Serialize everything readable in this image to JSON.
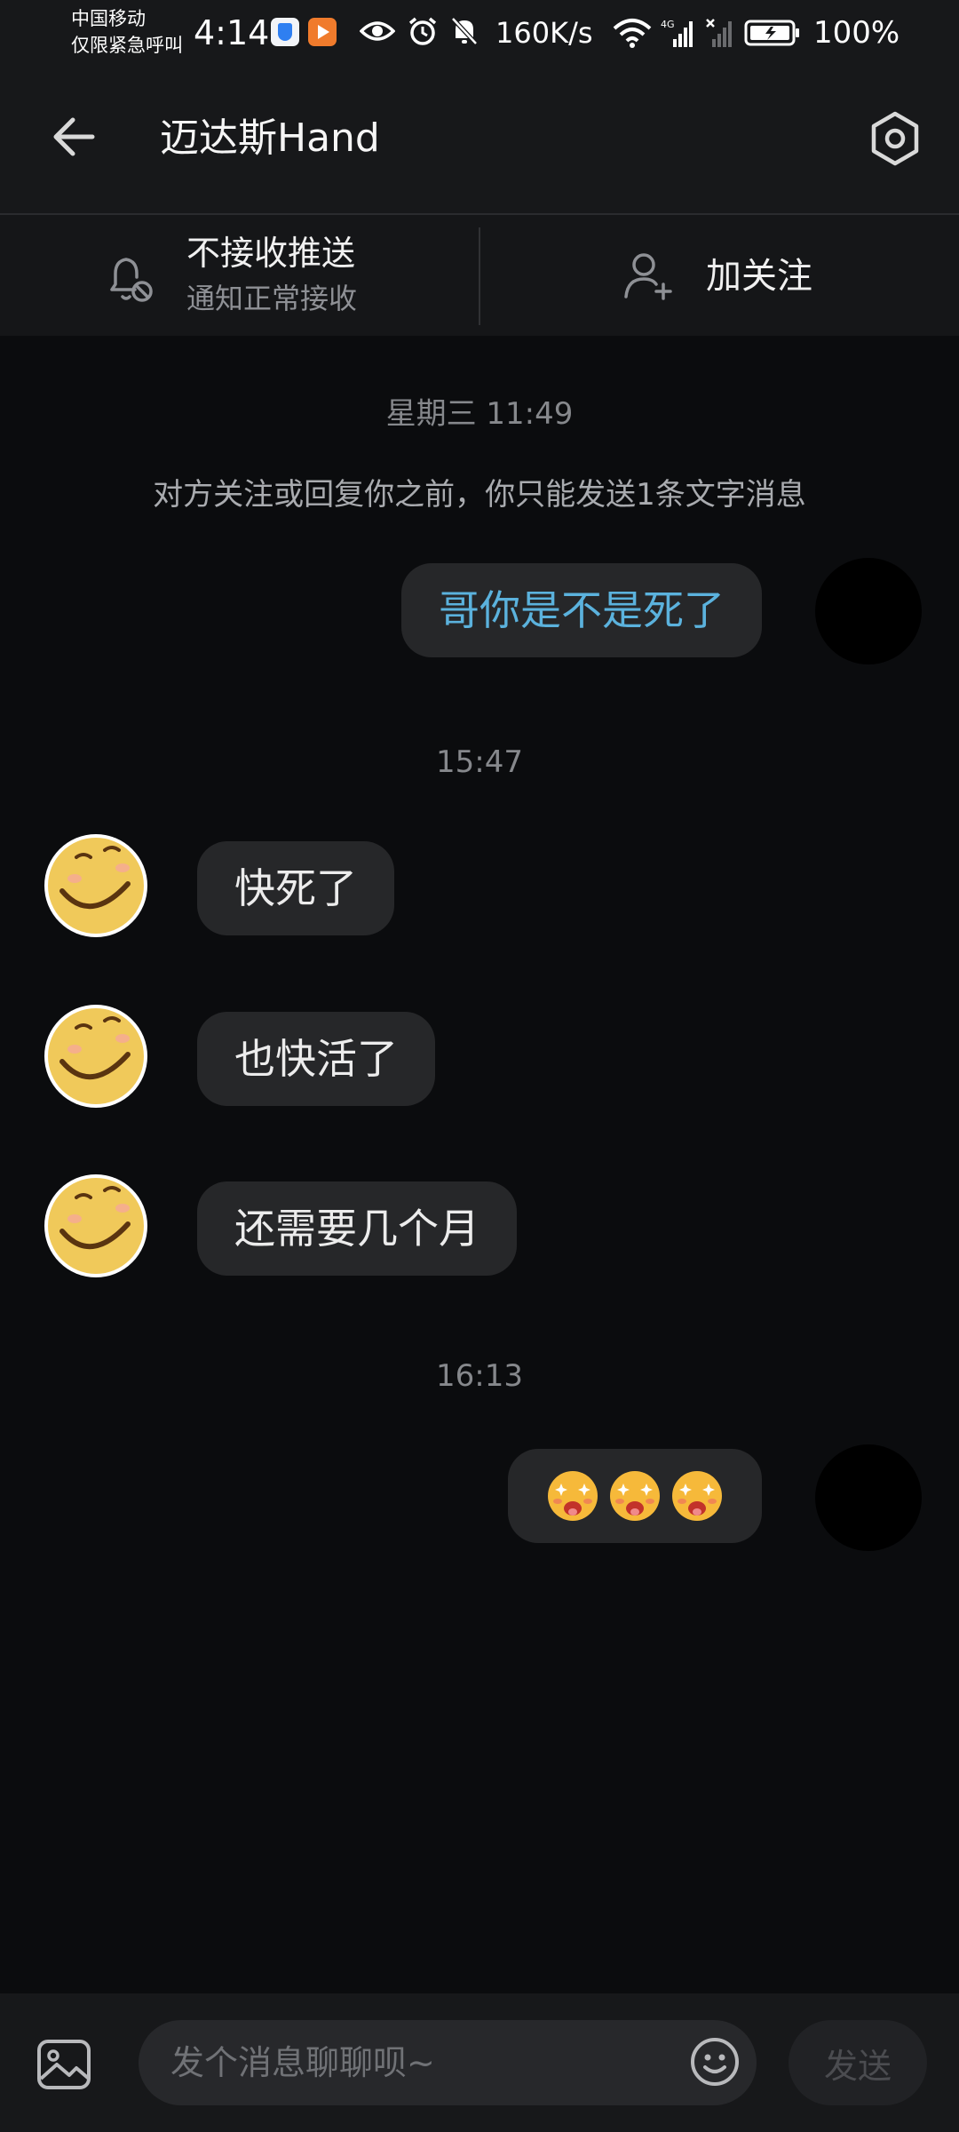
{
  "status_bar": {
    "carrier_line1": "中国移动",
    "carrier_line2": "仅限紧急呼叫",
    "time": "4:14",
    "net_speed": "160K/s",
    "network_type": "4G",
    "battery": "100%",
    "icons": [
      "shield-app-icon",
      "video-app-icon",
      "eye-icon",
      "alarm-icon",
      "mute-bell-icon",
      "wifi-icon",
      "signal-icon",
      "no-signal-icon",
      "battery-icon"
    ]
  },
  "header": {
    "title": "迈达斯Hand",
    "back_icon": "arrow-left-icon",
    "settings_icon": "hexagon-settings-icon"
  },
  "actions": {
    "push_label": "不接收推送",
    "push_sub": "通知正常接收",
    "follow_label": "加关注"
  },
  "chat": {
    "notice": "对方关注或回复你之前，你只能发送1条文字消息",
    "groups": [
      {
        "timestamp": "星期三 11:49"
      },
      {
        "timestamp": "15:47"
      },
      {
        "timestamp": "16:13"
      }
    ],
    "messages": [
      {
        "from": "me",
        "text": "哥你是不是死了"
      },
      {
        "from": "them",
        "text": "快死了"
      },
      {
        "from": "them",
        "text": "也快活了"
      },
      {
        "from": "them",
        "text": "还需要几个月"
      },
      {
        "from": "me",
        "type": "emoji",
        "emoji": [
          "star-eyes-emoji",
          "star-eyes-emoji",
          "star-eyes-emoji"
        ]
      }
    ]
  },
  "input_bar": {
    "placeholder": "发个消息聊聊呗~",
    "send_label": "发送"
  },
  "colors": {
    "background": "#0b0c0e",
    "header": "#17181a",
    "bubble": "#262729",
    "my_text": "#5bb2dd",
    "secondary_text": "#86888c"
  }
}
